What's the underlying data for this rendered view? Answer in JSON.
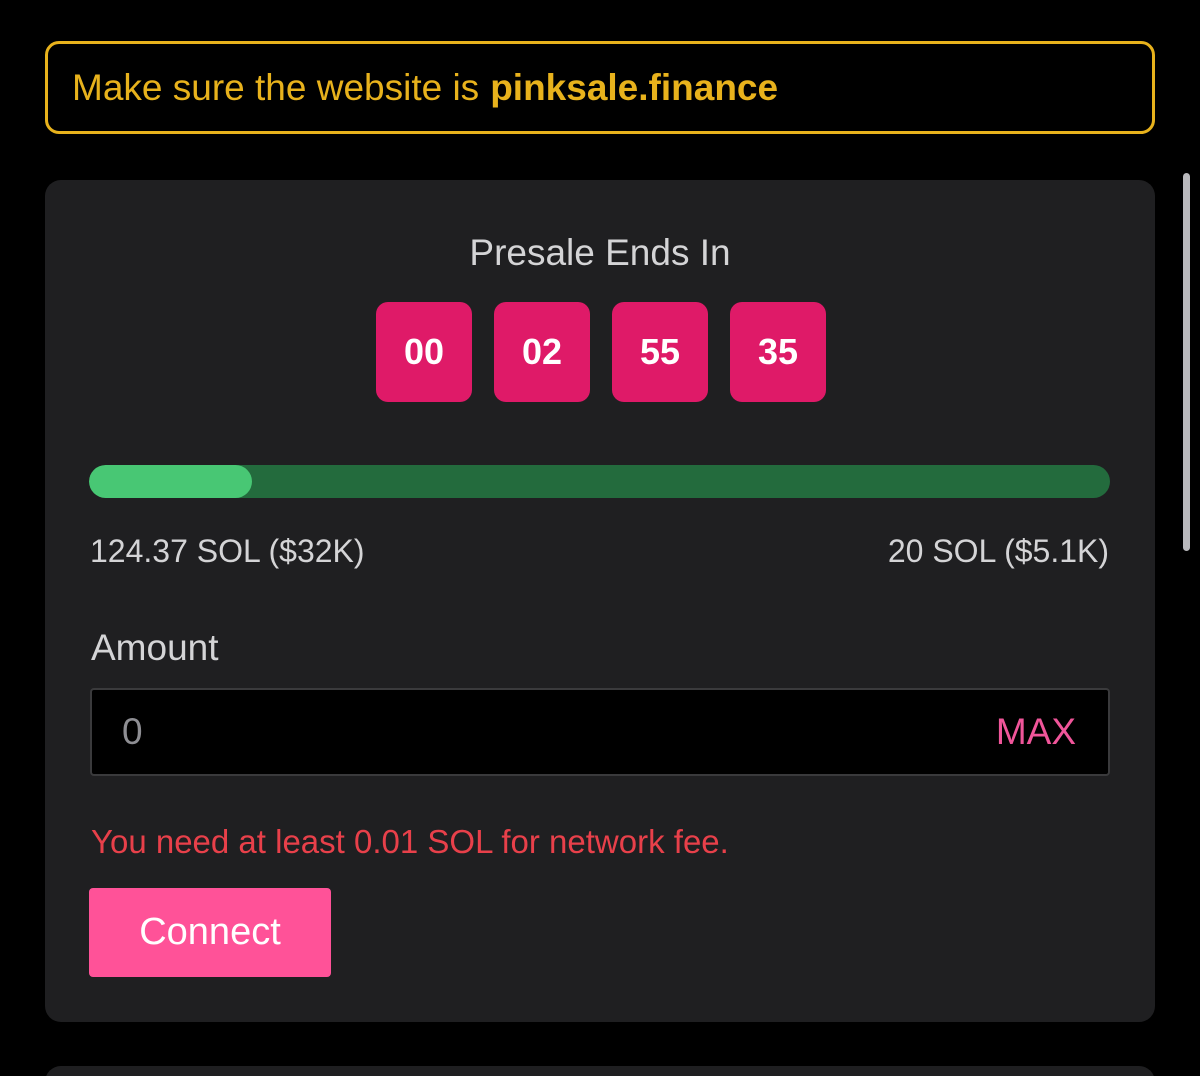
{
  "warning": {
    "text": "Make sure the website is",
    "domain": "pinksale.finance",
    "color": "#e8b21c"
  },
  "presale": {
    "title": "Presale Ends In",
    "countdown": [
      "00",
      "02",
      "55",
      "35"
    ],
    "progress_fraction": 0.16,
    "raised": "124.37 SOL ($32K)",
    "target": "20 SOL ($5.1K)"
  },
  "amount": {
    "label": "Amount",
    "value": "0",
    "max_label": "MAX"
  },
  "error": "You need at least 0.01 SOL for network fee.",
  "connect_label": "Connect",
  "colors": {
    "accent_pink": "#ff5298",
    "countdown_bg": "#df1a68",
    "progress_fill": "#48c774",
    "progress_track": "#236b3d",
    "error": "#e8404a"
  }
}
